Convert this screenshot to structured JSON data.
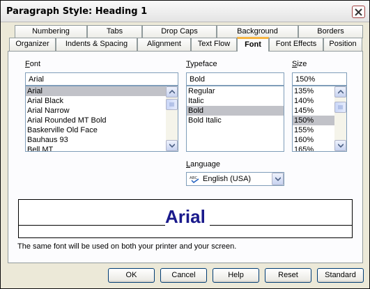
{
  "window": {
    "title": "Paragraph Style: Heading 1"
  },
  "tabs_row1": [
    "Numbering",
    "Tabs",
    "Drop Caps",
    "Background",
    "Borders"
  ],
  "tabs_row2": [
    "Organizer",
    "Indents & Spacing",
    "Alignment",
    "Text Flow",
    "Font",
    "Font Effects",
    "Position"
  ],
  "active_tab": "Font",
  "font": {
    "label": "Font",
    "value": "Arial",
    "items": [
      "Arial",
      "Arial Black",
      "Arial Narrow",
      "Arial Rounded MT Bold",
      "Baskerville Old Face",
      "Bauhaus 93",
      "Bell MT"
    ],
    "selected": "Arial"
  },
  "typeface": {
    "label": "Typeface",
    "value": "Bold",
    "items": [
      "Regular",
      "Italic",
      "Bold",
      "Bold Italic"
    ],
    "selected": "Bold"
  },
  "size": {
    "label": "Size",
    "value": "150%",
    "items": [
      "135%",
      "140%",
      "145%",
      "150%",
      "155%",
      "160%",
      "165%"
    ],
    "selected": "150%"
  },
  "language": {
    "label": "Language",
    "value": "English (USA)",
    "icon": "spellcheck-abc-icon"
  },
  "preview": {
    "text": "Arial",
    "color": "#1a1a8c"
  },
  "info_text": "The same font will be used on both your printer and your screen.",
  "buttons": {
    "ok": "OK",
    "cancel": "Cancel",
    "help": "Help",
    "reset": "Reset",
    "standard": "Standard"
  }
}
